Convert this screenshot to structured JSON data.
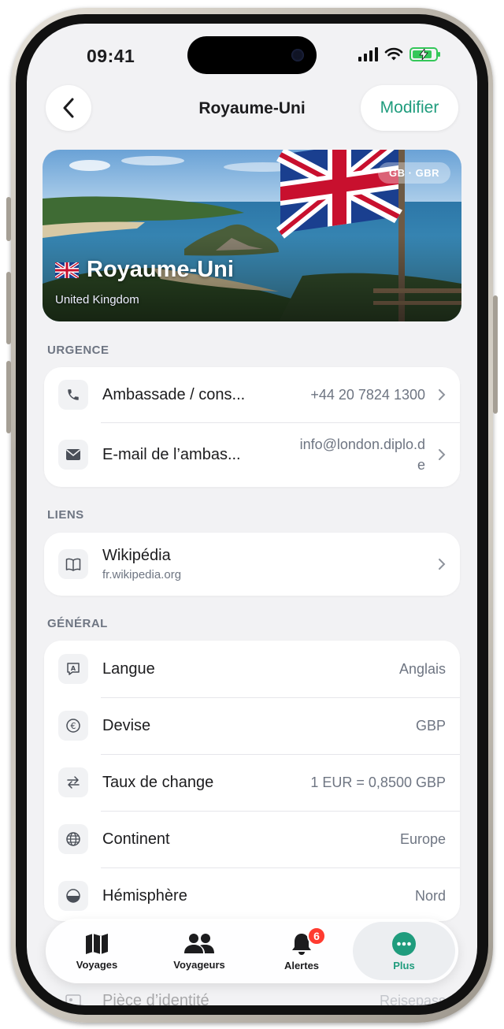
{
  "status": {
    "time": "09:41"
  },
  "header": {
    "title": "Royaume-Uni",
    "edit_label": "Modifier"
  },
  "hero": {
    "country_name": "Royaume-Uni",
    "english_name": "United Kingdom",
    "chip": "GB · GBR",
    "flag_emoji": "🇬🇧"
  },
  "sections": {
    "urgence": {
      "title": "URGENCE",
      "rows": [
        {
          "label": "Ambassade / cons...",
          "value": "+44 20 7824 1300",
          "icon": "phone-icon"
        },
        {
          "label": "E-mail de l’ambas...",
          "value_line1": "info@london.diplo.d",
          "value_line2": "e",
          "icon": "mail-icon"
        }
      ]
    },
    "liens": {
      "title": "LIENS",
      "rows": [
        {
          "label": "Wikipédia",
          "sub": "fr.wikipedia.org",
          "icon": "book-icon"
        }
      ]
    },
    "general": {
      "title": "GÉNÉRAL",
      "rows": [
        {
          "label": "Langue",
          "value": "Anglais",
          "icon": "language-icon"
        },
        {
          "label": "Devise",
          "value": "GBP",
          "icon": "euro-icon"
        },
        {
          "label": "Taux de change",
          "value": "1 EUR = 0,8500 GBP",
          "icon": "exchange-icon"
        },
        {
          "label": "Continent",
          "value": "Europe",
          "icon": "globe-icon"
        },
        {
          "label": "Hémisphère",
          "value": "Nord",
          "icon": "hemisphere-icon"
        }
      ]
    },
    "peek": {
      "label": "Pièce d’identité",
      "value": "Reisepass"
    }
  },
  "tabbar": {
    "tabs": [
      {
        "label": "Voyages",
        "icon": "map-icon"
      },
      {
        "label": "Voyageurs",
        "icon": "users-icon"
      },
      {
        "label": "Alertes",
        "icon": "bell-icon",
        "badge": "6"
      },
      {
        "label": "Plus",
        "icon": "more-icon",
        "active": true
      }
    ]
  },
  "colors": {
    "accent": "#1f9c7d",
    "badge": "#ff3b30",
    "secondary_text": "#6e7582"
  }
}
